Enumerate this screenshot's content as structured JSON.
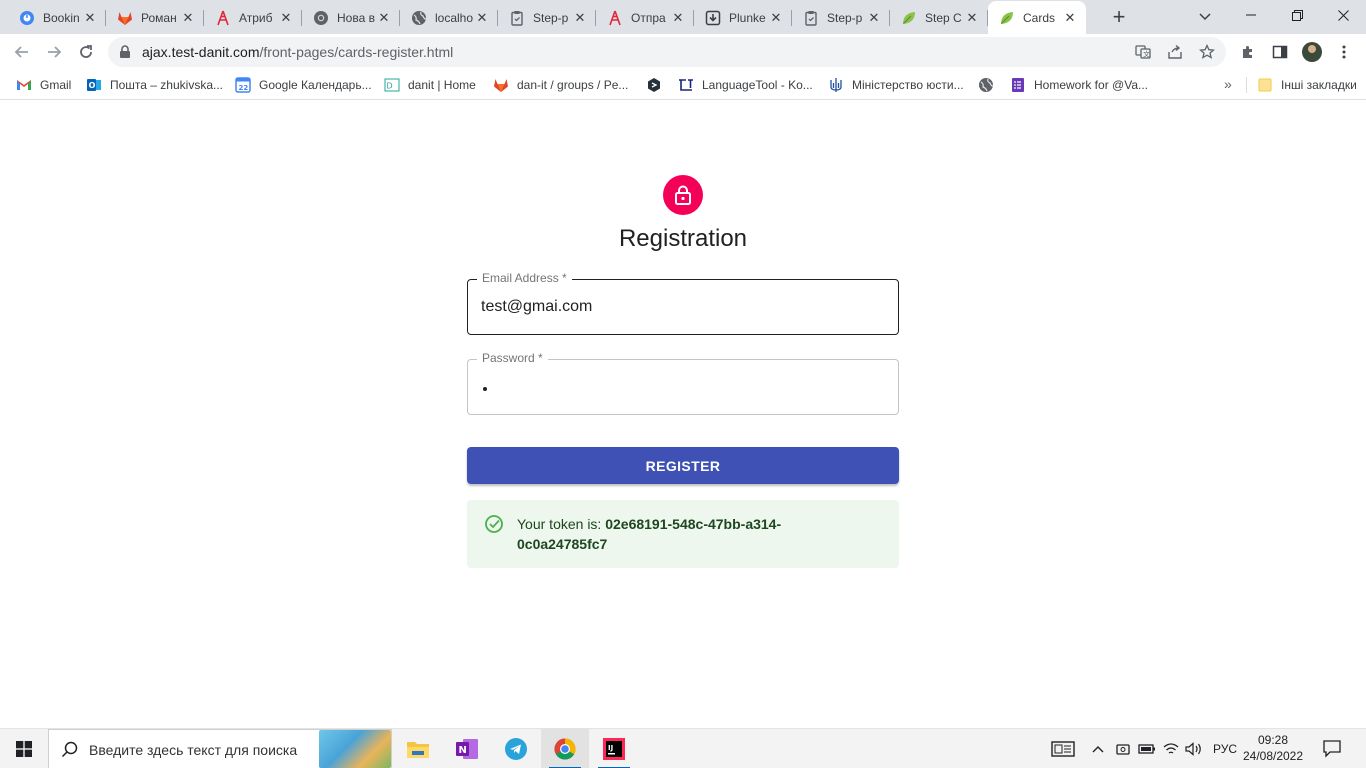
{
  "browser": {
    "tabs": [
      {
        "title": "Bookin",
        "icon": "booking-icon"
      },
      {
        "title": "Роман",
        "icon": "gitlab-icon"
      },
      {
        "title": "Атриб",
        "icon": "html-academy-icon"
      },
      {
        "title": "Нова в",
        "icon": "chrome-icon"
      },
      {
        "title": "localho",
        "icon": "globe-icon"
      },
      {
        "title": "Step-p",
        "icon": "clipboard-icon"
      },
      {
        "title": "Отпра",
        "icon": "html-academy-icon"
      },
      {
        "title": "Plunke",
        "icon": "plunker-icon"
      },
      {
        "title": "Step-p",
        "icon": "clipboard-icon"
      },
      {
        "title": "Step C",
        "icon": "leaf-icon"
      },
      {
        "title": "Cards",
        "icon": "leaf-icon",
        "active": true
      }
    ],
    "url_host": "ajax.test-danit.com",
    "url_path": "/front-pages/cards-register.html",
    "bookmarks": [
      {
        "label": "Gmail",
        "icon": "gmail-icon"
      },
      {
        "label": "Пошта – zhukivska...",
        "icon": "outlook-icon"
      },
      {
        "label": "Google Календарь...",
        "icon": "calendar-icon"
      },
      {
        "label": "danit | Home",
        "icon": "danit-icon"
      },
      {
        "label": "dan-it / groups / Pe...",
        "icon": "gitlab-icon"
      },
      {
        "label": "",
        "icon": "hex-icon"
      },
      {
        "label": "LanguageTool - Ko...",
        "icon": "languagetool-icon"
      },
      {
        "label": "Міністерство юсти...",
        "icon": "trident-icon"
      },
      {
        "label": "",
        "icon": "globe-icon"
      },
      {
        "label": "Homework for @Va...",
        "icon": "forms-icon"
      }
    ],
    "other_bookmarks": "Інші закладки"
  },
  "page": {
    "title": "Registration",
    "email": {
      "label": "Email Address *",
      "value": "test@gmai.com"
    },
    "password": {
      "label": "Password *"
    },
    "register_label": "REGISTER",
    "alert": {
      "prefix": "Your token is: ",
      "token": "02e68191-548c-47bb-a314-0c0a24785fc7"
    },
    "colors": {
      "accent": "#f50057",
      "primary": "#3f51b5",
      "success_bg": "#edf7ed",
      "success_icon": "#4caf50"
    }
  },
  "taskbar": {
    "search_placeholder": "Введите здесь текст для поиска",
    "language": "РУС",
    "time": "09:28",
    "date": "24/08/2022"
  }
}
